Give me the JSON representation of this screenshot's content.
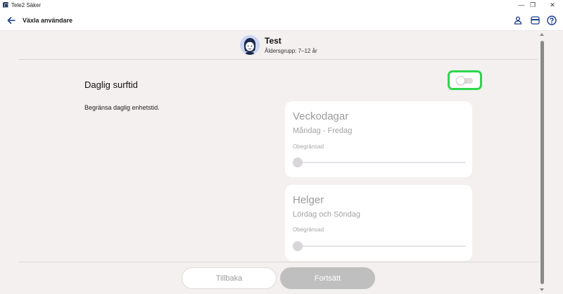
{
  "window": {
    "title": "Tele2 Säker",
    "minimize": "—",
    "maximize": "❐",
    "close": "✕"
  },
  "appbar": {
    "title": "Växla användare",
    "back_icon": "arrow-left-icon"
  },
  "profile": {
    "name": "Test",
    "age_group": "Åldersgrupp: 7–12 år"
  },
  "section": {
    "title": "Daglig surftid",
    "description": "Begränsa daglig enhetstid.",
    "toggle_on": false
  },
  "cards": [
    {
      "title": "Veckodagar",
      "subtitle": "Måndag - Fredag",
      "limit": "Obegränsad"
    },
    {
      "title": "Helger",
      "subtitle": "Lördag och Söndag",
      "limit": "Obegränsad"
    }
  ],
  "footer": {
    "back_label": "Tillbaka",
    "next_label": "Fortsätt"
  },
  "colors": {
    "accent": "#1b3f8f",
    "highlight": "#2dd64b",
    "background": "#f3f0ef"
  }
}
